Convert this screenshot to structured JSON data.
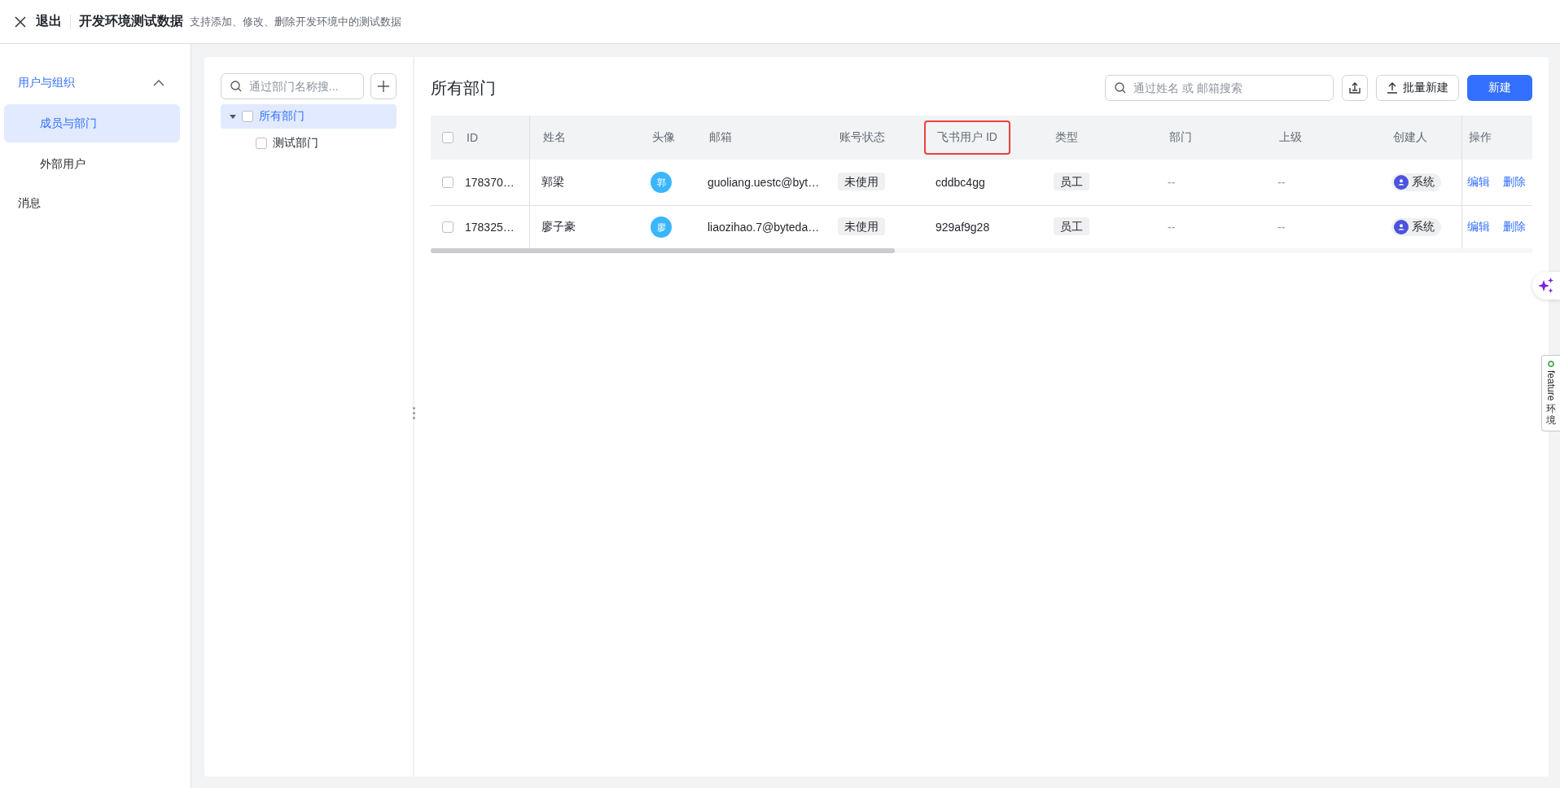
{
  "header": {
    "exit_label": "退出",
    "title": "开发环境测试数据",
    "subtitle": "支持添加、修改、删除开发环境中的测试数据"
  },
  "sidebar": {
    "groups": [
      {
        "label": "用户与组织",
        "expanded": true,
        "children": [
          {
            "label": "成员与部门",
            "selected": true
          },
          {
            "label": "外部用户",
            "selected": false
          }
        ]
      },
      {
        "label": "消息"
      }
    ]
  },
  "tree_panel": {
    "search_placeholder": "通过部门名称搜...",
    "nodes": [
      {
        "label": "所有部门",
        "expanded": true,
        "selected": true,
        "checked": false,
        "children": [
          {
            "label": "测试部门",
            "selected": false,
            "checked": false
          }
        ]
      }
    ]
  },
  "main": {
    "title": "所有部门",
    "search_placeholder": "通过姓名 或 邮箱搜索",
    "batch_button": "批量新建",
    "new_button": "新建",
    "table": {
      "select_all_checked": false,
      "columns": [
        {
          "label": "ID",
          "highlighted": false
        },
        {
          "label": "姓名",
          "highlighted": false
        },
        {
          "label": "头像",
          "highlighted": false
        },
        {
          "label": "邮箱",
          "highlighted": false
        },
        {
          "label": "账号状态",
          "highlighted": false
        },
        {
          "label": "飞书用户 ID",
          "highlighted": true
        },
        {
          "label": "类型",
          "highlighted": false
        },
        {
          "label": "部门",
          "highlighted": false
        },
        {
          "label": "上级",
          "highlighted": false
        },
        {
          "label": "创建人",
          "highlighted": false
        },
        {
          "label": "操作",
          "highlighted": false
        }
      ],
      "rows": [
        {
          "checked": false,
          "id": "178370…",
          "name": "郭梁",
          "avatar": "郭",
          "email": "guoliang.uestc@byt…",
          "status": "未使用",
          "feishu_id": "cddbc4gg",
          "type": "员工",
          "department": "--",
          "manager": "--",
          "creator": "系统",
          "actions": [
            "编辑",
            "删除"
          ]
        },
        {
          "checked": false,
          "id": "178325…",
          "name": "廖子豪",
          "avatar": "廖",
          "email": "liaozihao.7@byteda…",
          "status": "未使用",
          "feishu_id": "929af9g28",
          "type": "员工",
          "department": "--",
          "manager": "--",
          "creator": "系统",
          "actions": [
            "编辑",
            "删除"
          ]
        }
      ]
    }
  },
  "feature_tab": {
    "label": "feature",
    "label_cjk": "环境"
  }
}
